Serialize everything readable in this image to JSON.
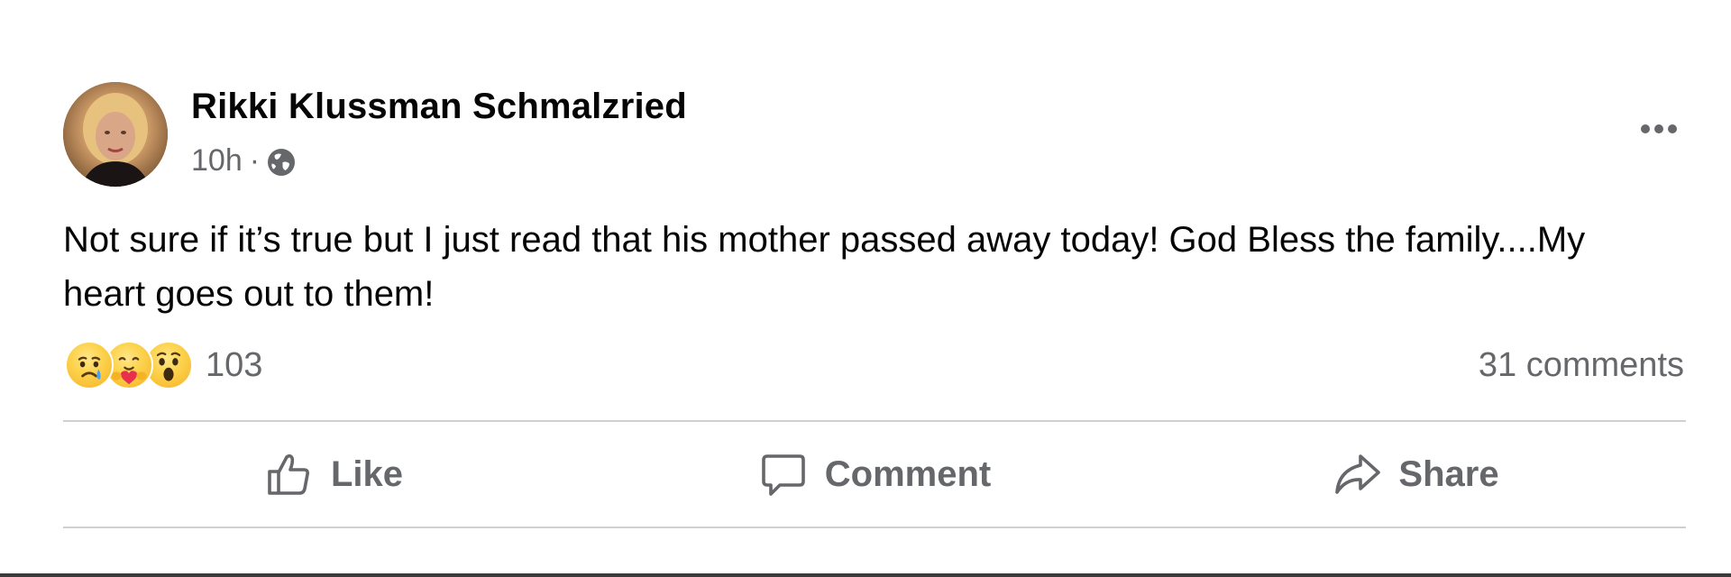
{
  "post": {
    "author": "Rikki Klussman Schmalzried",
    "time": "10h",
    "separator": "·",
    "privacy_icon": "globe-icon",
    "text": "Not sure if it’s true but I just read that his mother passed away today! God Bless the family....My heart goes out to them!",
    "reactions": {
      "icons": [
        "sad-reaction-icon",
        "care-reaction-icon",
        "wow-reaction-icon"
      ],
      "count": "103"
    },
    "comments": "31 comments"
  },
  "actions": {
    "like": "Like",
    "comment": "Comment",
    "share": "Share"
  },
  "colors": {
    "text_primary": "#050505",
    "text_secondary": "#65676b",
    "divider": "#ced0d4",
    "reaction_yellow": "#f7b125"
  }
}
